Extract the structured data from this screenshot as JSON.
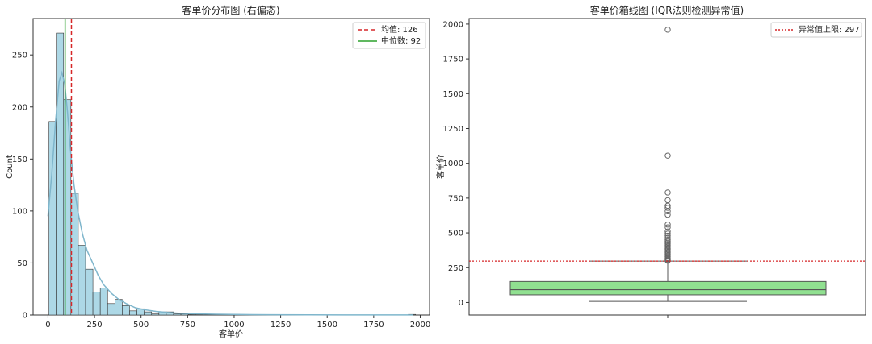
{
  "chart_data": [
    {
      "type": "bar",
      "title": "客单价分布图 (右偏态)",
      "xlabel": "客单价",
      "ylabel": "Count",
      "xlim": [
        -80,
        2050
      ],
      "ylim": [
        0,
        285
      ],
      "xticks": [
        0,
        250,
        500,
        750,
        1000,
        1250,
        1500,
        1750,
        2000
      ],
      "yticks": [
        0,
        50,
        100,
        150,
        200,
        250
      ],
      "bin_width": 39.4,
      "bin_start": 5,
      "counts": [
        186,
        271,
        207,
        117,
        67,
        44,
        22,
        26,
        11,
        15,
        9,
        4,
        6,
        3,
        1,
        3,
        3,
        1,
        1,
        0.6,
        0.4,
        0,
        0,
        0,
        0,
        0.6,
        0,
        0,
        0,
        0,
        0,
        0,
        0,
        0,
        0,
        0,
        0,
        0,
        0,
        0,
        0,
        0,
        0,
        0,
        0,
        0,
        0,
        0,
        0,
        0.6
      ],
      "kde": {
        "x": [
          0,
          20,
          40,
          60,
          75,
          90,
          105,
          120,
          140,
          160,
          185,
          210,
          240,
          270,
          300,
          340,
          380,
          420,
          470,
          520,
          580,
          640,
          700,
          800,
          900,
          1000,
          1100,
          1200,
          1400,
          1600,
          1800,
          1960
        ],
        "y": [
          95,
          135,
          185,
          225,
          233,
          222,
          195,
          160,
          125,
          100,
          78,
          62,
          50,
          38,
          29,
          21,
          15,
          11,
          7,
          5,
          3.5,
          2.5,
          1.8,
          1.2,
          0.8,
          0.6,
          0.4,
          0.3,
          0.2,
          0.1,
          0.1,
          0.1
        ]
      },
      "reference_lines": [
        {
          "label": "均值: 126",
          "value": 126,
          "color": "#d62728",
          "style": "dashed"
        },
        {
          "label": "中位数: 92",
          "value": 92,
          "color": "#2ca02c",
          "style": "solid"
        }
      ],
      "bar_color": "#add8e6",
      "kde_color": "#7fb6cc",
      "legend": "upper-right"
    },
    {
      "type": "box",
      "title": "客单价箱线图 (IQR法则检测异常值)",
      "xlabel": "",
      "ylabel": "客单价",
      "ylim": [
        -90,
        2040
      ],
      "yticks": [
        0,
        250,
        500,
        750,
        1000,
        1250,
        1500,
        1750,
        2000
      ],
      "box": {
        "whisker_low": 8,
        "q1": 55,
        "median": 92,
        "q3": 151,
        "whisker_high": 297
      },
      "outliers": [
        1960,
        1055,
        790,
        735,
        695,
        680,
        655,
        630,
        560,
        540,
        510,
        495,
        480,
        465,
        450,
        440,
        430,
        420,
        410,
        400,
        390,
        380,
        370,
        360,
        350,
        340,
        330,
        320,
        312,
        305,
        300
      ],
      "reference_lines": [
        {
          "label": "异常值上限: 297",
          "value": 297,
          "color": "#d62728",
          "style": "dotted"
        }
      ],
      "box_color": "#90e090",
      "legend": "upper-right"
    }
  ]
}
